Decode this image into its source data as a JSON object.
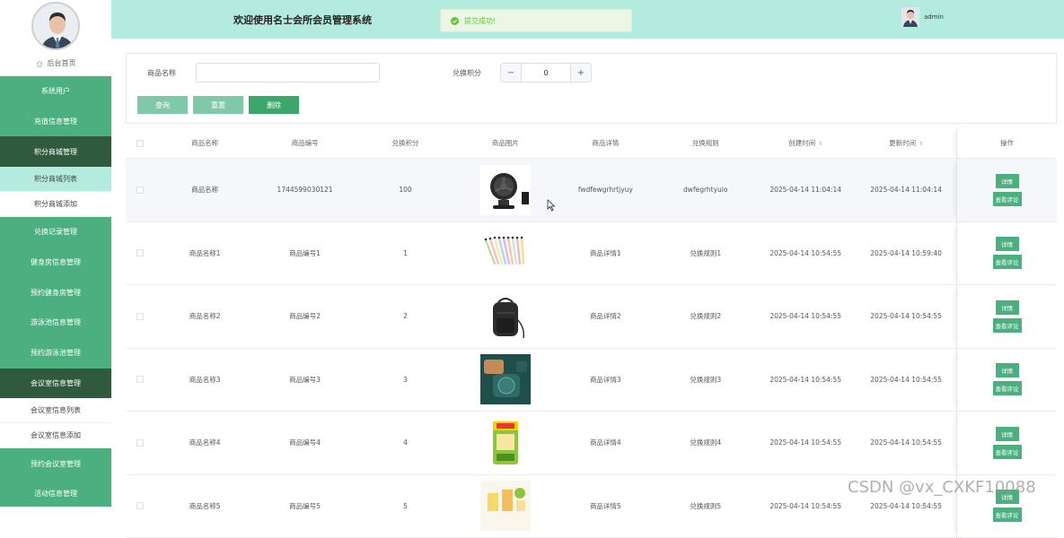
{
  "header": {
    "title": "欢迎使用名士会所会员管理系统",
    "toast": "提交成功!",
    "username": "admin"
  },
  "sidebar": {
    "home_label": "后台首页",
    "items": [
      {
        "label": "系统用户",
        "type": "menu"
      },
      {
        "label": "充值信息管理",
        "type": "menu"
      },
      {
        "label": "积分商城管理",
        "type": "menu-active"
      },
      {
        "label": "积分商城列表",
        "type": "sub-selected"
      },
      {
        "label": "积分商城添加",
        "type": "sub"
      },
      {
        "label": "兑换记录管理",
        "type": "menu"
      },
      {
        "label": "健身房信息管理",
        "type": "menu"
      },
      {
        "label": "预约健身房管理",
        "type": "menu"
      },
      {
        "label": "游泳池信息管理",
        "type": "menu"
      },
      {
        "label": "预约游泳池管理",
        "type": "menu"
      },
      {
        "label": "会议室信息管理",
        "type": "menu-active"
      },
      {
        "label": "会议室信息列表",
        "type": "sub"
      },
      {
        "label": "会议室信息添加",
        "type": "sub"
      },
      {
        "label": "预约会议室管理",
        "type": "menu"
      },
      {
        "label": "活动信息管理",
        "type": "menu"
      }
    ]
  },
  "search": {
    "name_label": "商品名称",
    "name_value": "",
    "points_label": "兑换积分",
    "points_value": "0",
    "minus": "−",
    "plus": "+",
    "query_btn": "查询",
    "reset_btn": "重置",
    "delete_btn": "删除"
  },
  "table": {
    "headers": {
      "name": "商品名称",
      "code": "商品编号",
      "points": "兑换积分",
      "image": "商品图片",
      "detail": "商品详情",
      "rule": "兑换规则",
      "ctime": "创建时间",
      "utime": "更新时间",
      "ops": "操作"
    },
    "sort_icon": "⇕",
    "detail_btn": "详情",
    "comment_btn": "查看评论",
    "rows": [
      {
        "name": "商品名称",
        "code": "1744599030121",
        "points": "100",
        "image": "fan-icon",
        "detail": "fwdfewgrhrtjyuy",
        "rule": "dwfegrhtyuio",
        "ctime": "2025-04-14 11:04:14",
        "utime": "2025-04-14 11:04:14"
      },
      {
        "name": "商品名称1",
        "code": "商品编号1",
        "points": "1",
        "image": "pens-icon",
        "detail": "商品详情1",
        "rule": "兑换规则1",
        "ctime": "2025-04-14 10:54:55",
        "utime": "2025-04-14 10:59:40"
      },
      {
        "name": "商品名称2",
        "code": "商品编号2",
        "points": "2",
        "image": "backpack-icon",
        "detail": "商品详情2",
        "rule": "兑换规则2",
        "ctime": "2025-04-14 10:54:55",
        "utime": "2025-04-14 10:54:55"
      },
      {
        "name": "商品名称3",
        "code": "商品编号3",
        "points": "3",
        "image": "gadget-icon",
        "detail": "商品详情3",
        "rule": "兑换规则3",
        "ctime": "2025-04-14 10:54:55",
        "utime": "2025-04-14 10:54:55"
      },
      {
        "name": "商品名称4",
        "code": "商品编号4",
        "points": "4",
        "image": "rice-bag-icon",
        "detail": "商品详情4",
        "rule": "兑换规则4",
        "ctime": "2025-04-14 10:54:55",
        "utime": "2025-04-14 10:54:55"
      },
      {
        "name": "商品名称5",
        "code": "商品编号5",
        "points": "5",
        "image": "drinks-icon",
        "detail": "商品详情5",
        "rule": "兑换规则5",
        "ctime": "2025-04-14 10:54:55",
        "utime": "2025-04-14 10:54:55"
      }
    ]
  },
  "watermark": "CSDN @vx_CXKF10088"
}
